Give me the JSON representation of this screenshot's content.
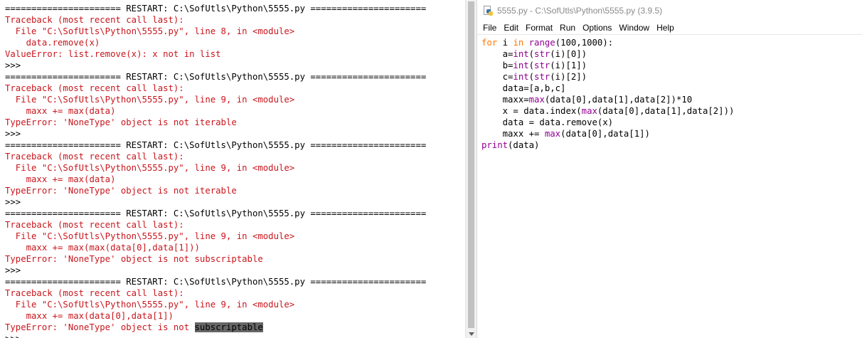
{
  "shell": {
    "lines": [
      {
        "cls": "c-black",
        "text": "====================== RESTART: C:\\SofUtls\\Python\\5555.py ======================"
      },
      {
        "cls": "c-red",
        "text": "Traceback (most recent call last):"
      },
      {
        "cls": "c-red",
        "text": "  File \"C:\\SofUtls\\Python\\5555.py\", line 8, in <module>"
      },
      {
        "cls": "c-red",
        "text": "    data.remove(x)"
      },
      {
        "cls": "c-red",
        "text": "ValueError: list.remove(x): x not in list"
      },
      {
        "cls": "c-prompt",
        "text": ">>>"
      },
      {
        "cls": "c-black",
        "text": "====================== RESTART: C:\\SofUtls\\Python\\5555.py ======================"
      },
      {
        "cls": "c-red",
        "text": "Traceback (most recent call last):"
      },
      {
        "cls": "c-red",
        "text": "  File \"C:\\SofUtls\\Python\\5555.py\", line 9, in <module>"
      },
      {
        "cls": "c-red",
        "text": "    maxx += max(data)"
      },
      {
        "cls": "c-red",
        "text": "TypeError: 'NoneType' object is not iterable"
      },
      {
        "cls": "c-prompt",
        "text": ">>>"
      },
      {
        "cls": "c-black",
        "text": "====================== RESTART: C:\\SofUtls\\Python\\5555.py ======================"
      },
      {
        "cls": "c-red",
        "text": "Traceback (most recent call last):"
      },
      {
        "cls": "c-red",
        "text": "  File \"C:\\SofUtls\\Python\\5555.py\", line 9, in <module>"
      },
      {
        "cls": "c-red",
        "text": "    maxx += max(data)"
      },
      {
        "cls": "c-red",
        "text": "TypeError: 'NoneType' object is not iterable"
      },
      {
        "cls": "c-prompt",
        "text": ">>>"
      },
      {
        "cls": "c-black",
        "text": "====================== RESTART: C:\\SofUtls\\Python\\5555.py ======================"
      },
      {
        "cls": "c-red",
        "text": "Traceback (most recent call last):"
      },
      {
        "cls": "c-red",
        "text": "  File \"C:\\SofUtls\\Python\\5555.py\", line 9, in <module>"
      },
      {
        "cls": "c-red",
        "text": "    maxx += max(max(data[0],data[1]))"
      },
      {
        "cls": "c-red",
        "text": "TypeError: 'NoneType' object is not subscriptable"
      },
      {
        "cls": "c-prompt",
        "text": ">>>"
      },
      {
        "cls": "c-black",
        "text": "====================== RESTART: C:\\SofUtls\\Python\\5555.py ======================"
      },
      {
        "cls": "c-red",
        "text": "Traceback (most recent call last):"
      },
      {
        "cls": "c-red",
        "text": "  File \"C:\\SofUtls\\Python\\5555.py\", line 9, in <module>"
      },
      {
        "cls": "c-red",
        "text": "    maxx += max(data[0],data[1])"
      },
      {
        "cls": "c-red",
        "text": "TypeError: 'NoneType' object is not ",
        "highlight": "subscriptable"
      },
      {
        "cls": "c-prompt",
        "text": ">>>"
      }
    ]
  },
  "editor": {
    "title": "5555.py - C:\\SofUtls\\Python\\5555.py (3.9.5)",
    "menu": [
      "File",
      "Edit",
      "Format",
      "Run",
      "Options",
      "Window",
      "Help"
    ],
    "code": [
      [
        {
          "t": "kw",
          "s": "for"
        },
        {
          "t": "tx",
          "s": " i "
        },
        {
          "t": "kw",
          "s": "in"
        },
        {
          "t": "tx",
          "s": " "
        },
        {
          "t": "bi",
          "s": "range"
        },
        {
          "t": "tx",
          "s": "(100,1000):"
        }
      ],
      [
        {
          "t": "tx",
          "s": "    a="
        },
        {
          "t": "bi",
          "s": "int"
        },
        {
          "t": "tx",
          "s": "("
        },
        {
          "t": "bi",
          "s": "str"
        },
        {
          "t": "tx",
          "s": "(i)[0])"
        }
      ],
      [
        {
          "t": "tx",
          "s": "    b="
        },
        {
          "t": "bi",
          "s": "int"
        },
        {
          "t": "tx",
          "s": "("
        },
        {
          "t": "bi",
          "s": "str"
        },
        {
          "t": "tx",
          "s": "(i)[1])"
        }
      ],
      [
        {
          "t": "tx",
          "s": "    c="
        },
        {
          "t": "bi",
          "s": "int"
        },
        {
          "t": "tx",
          "s": "("
        },
        {
          "t": "bi",
          "s": "str"
        },
        {
          "t": "tx",
          "s": "(i)[2])"
        }
      ],
      [
        {
          "t": "tx",
          "s": "    data=[a,b,c]"
        }
      ],
      [
        {
          "t": "tx",
          "s": "    maxx="
        },
        {
          "t": "bi",
          "s": "max"
        },
        {
          "t": "tx",
          "s": "(data[0],data[1],data[2])*10"
        }
      ],
      [
        {
          "t": "tx",
          "s": "    x = data.index("
        },
        {
          "t": "bi",
          "s": "max"
        },
        {
          "t": "tx",
          "s": "(data[0],data[1],data[2]))"
        }
      ],
      [
        {
          "t": "tx",
          "s": "    data = data.remove(x)"
        }
      ],
      [
        {
          "t": "tx",
          "s": "    maxx += "
        },
        {
          "t": "bi",
          "s": "max"
        },
        {
          "t": "tx",
          "s": "(data[0],data[1])"
        }
      ],
      [
        {
          "t": "bi",
          "s": "print"
        },
        {
          "t": "tx",
          "s": "(data)"
        }
      ]
    ]
  }
}
